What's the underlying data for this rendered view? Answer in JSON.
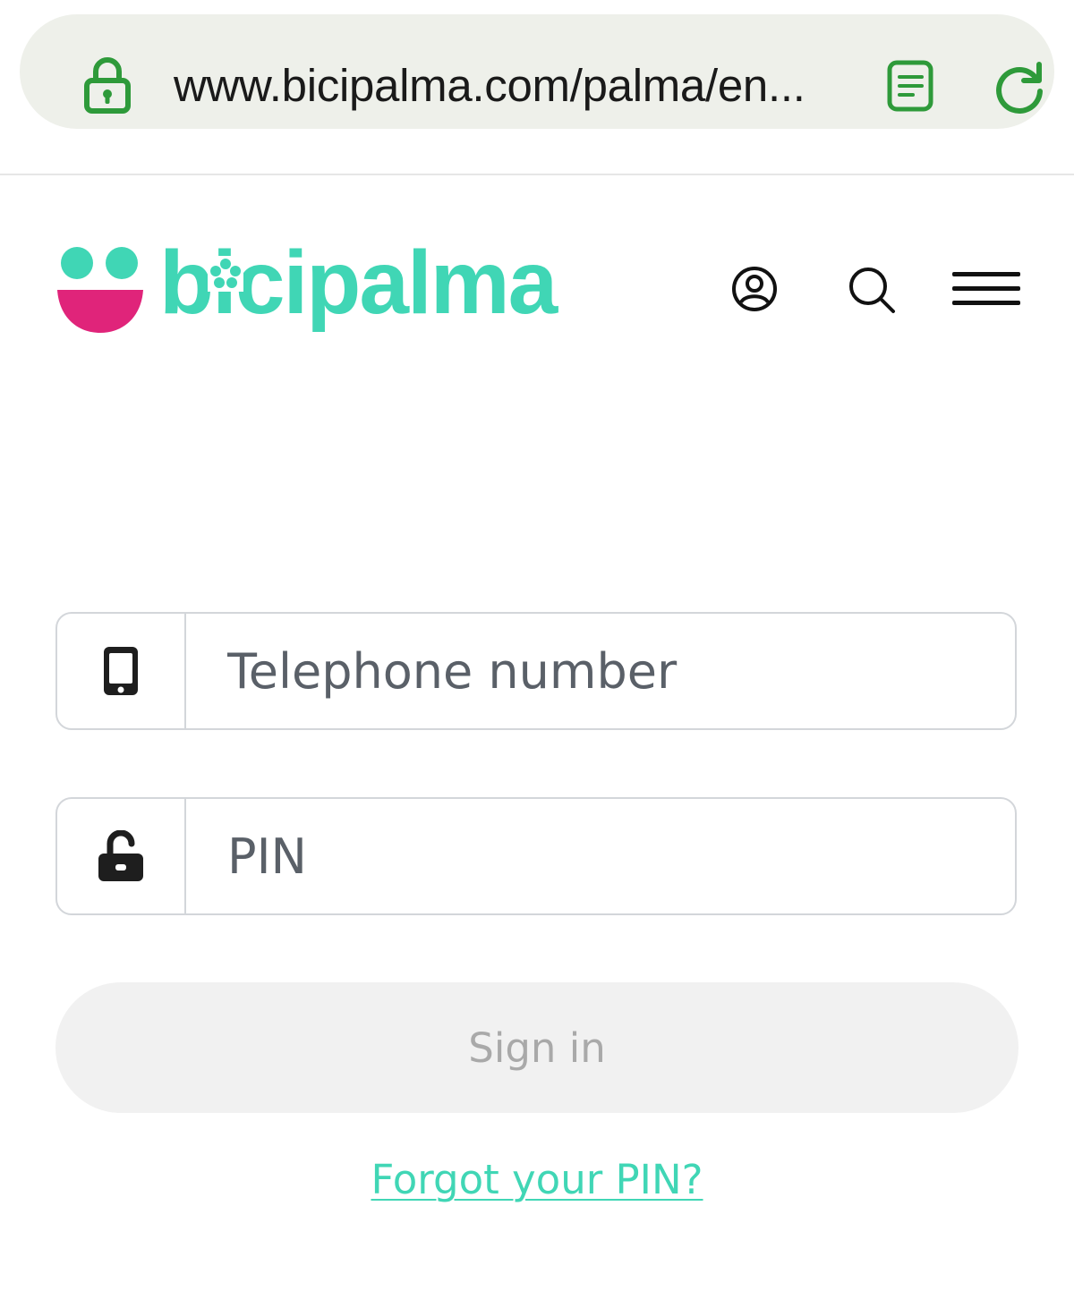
{
  "browser": {
    "url": "www.bicipalma.com/palma/en...",
    "icons": [
      "lock-icon",
      "reader-mode-icon",
      "reload-icon"
    ],
    "accent_color": "#2e9a3a"
  },
  "header": {
    "logo_text": "bicipalma",
    "brand_color": "#40d6b5",
    "brand_pink": "#e0247a",
    "icons": [
      "account-icon",
      "search-icon",
      "menu-icon"
    ]
  },
  "login": {
    "phone_placeholder": "Telephone number",
    "pin_placeholder": "PIN",
    "signin_label": "Sign in",
    "forgot_label": "Forgot your PIN?",
    "icons": [
      "phone-icon",
      "unlock-icon"
    ]
  }
}
